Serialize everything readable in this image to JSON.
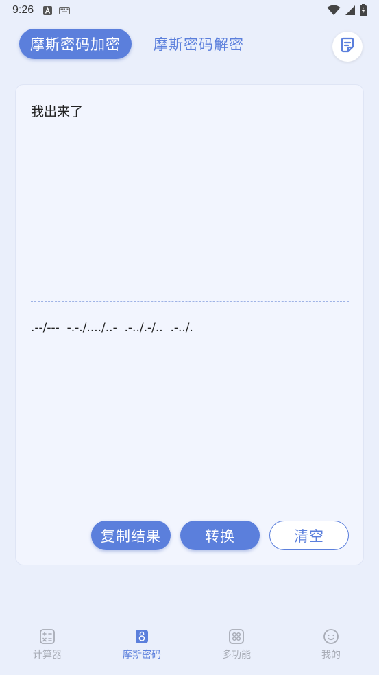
{
  "status": {
    "time": "9:26"
  },
  "tabs": {
    "encrypt": "摩斯密码加密",
    "decrypt": "摩斯密码解密"
  },
  "editor": {
    "input": "我出来了",
    "output": ".--/---  -.-./..../..-  .-../.-/..  .-../."
  },
  "actions": {
    "copy": "复制结果",
    "convert": "转换",
    "clear": "清空"
  },
  "nav": {
    "items": [
      {
        "label": "计算器",
        "icon": "calculator-icon"
      },
      {
        "label": "摩斯密码",
        "icon": "lock-icon"
      },
      {
        "label": "多功能",
        "icon": "grid-icon"
      },
      {
        "label": "我的",
        "icon": "smile-icon"
      }
    ]
  },
  "colors": {
    "accent": "#5b7fdc",
    "background": "#eaeffb",
    "inactive": "#a8acb6"
  }
}
